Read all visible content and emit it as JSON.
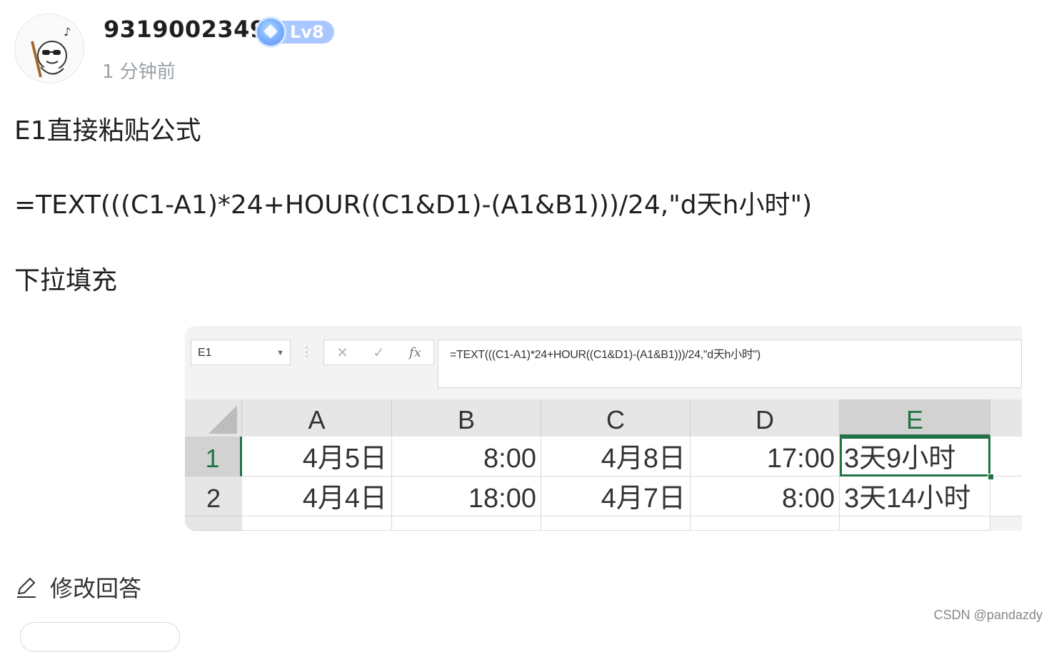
{
  "author": {
    "username": "9319002349",
    "level": "Lv8",
    "time": "1 分钟前"
  },
  "answer": {
    "line1": "E1直接粘贴公式",
    "line2": "=TEXT(((C1-A1)*24+HOUR((C1&D1)-(A1&B1)))/24,\"d天h小时\")",
    "line3": "下拉填充"
  },
  "excel": {
    "name_box": "E1",
    "formula": "=TEXT(((C1-A1)*24+HOUR((C1&D1)-(A1&B1)))/24,\"d天h小时\")",
    "columns": [
      "A",
      "B",
      "C",
      "D",
      "E"
    ],
    "rows": [
      {
        "num": "1",
        "cells": [
          "4月5日",
          "8:00",
          "4月8日",
          "17:00",
          "3天9小时"
        ]
      },
      {
        "num": "2",
        "cells": [
          "4月4日",
          "18:00",
          "4月7日",
          "8:00",
          "3天14小时"
        ]
      }
    ]
  },
  "edit_label": "修改回答",
  "watermark": "CSDN @pandazdy",
  "colors": {
    "excel_green": "#217346",
    "level_badge": "#a9c8ff"
  }
}
